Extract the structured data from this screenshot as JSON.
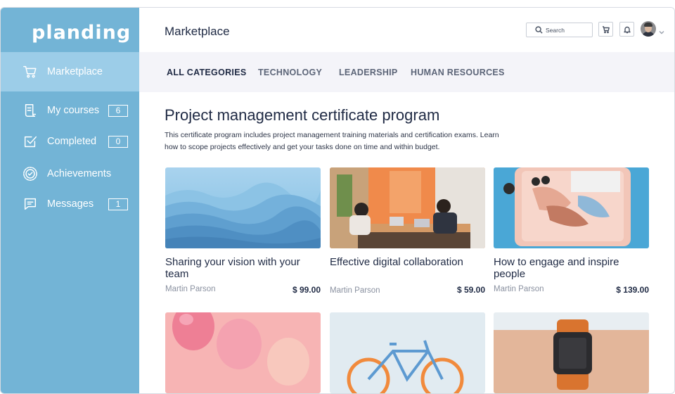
{
  "app": {
    "logo": "planding"
  },
  "sidebar": {
    "items": [
      {
        "label": "Marketplace",
        "count": null
      },
      {
        "label": "My courses",
        "count": "6"
      },
      {
        "label": "Completed",
        "count": "0"
      },
      {
        "label": "Achievements",
        "count": null
      },
      {
        "label": "Messages",
        "count": "1"
      }
    ]
  },
  "header": {
    "title": "Marketplace",
    "search_placeholder": "Search"
  },
  "tabs": [
    "ALL CATEGORIES",
    "TECHNOLOGY",
    "LEADERSHIP",
    "HUMAN RESOURCES"
  ],
  "main": {
    "title": "Project management certificate program",
    "description": "This certificate program includes project management training materials and certification exams. Learn how to scope projects effectively and get your tasks done on time and within budget."
  },
  "courses": [
    {
      "title": "Sharing your vision with your team",
      "author": "Martin Parson",
      "price": "$ 99.00"
    },
    {
      "title": "Effective digital collaboration",
      "author": "Martin Parson",
      "price": "$ 59.00"
    },
    {
      "title": "How to engage and inspire people",
      "author": "Martin Parson",
      "price": "$ 139.00"
    }
  ],
  "icons": {
    "marketplace": "cart-icon",
    "my_courses": "document-list-icon",
    "completed": "checkbox-icon",
    "achievements": "badge-check-icon",
    "messages": "chat-bubble-icon",
    "search": "search-icon",
    "cart": "cart-icon",
    "notifications": "bell-icon",
    "menu": "chevron-down-icon"
  },
  "colors": {
    "sidebar": "#73b4d6",
    "sidebar_active": "#9ccde8",
    "text_primary": "#1f2a44",
    "tab_bar": "#f4f4f9"
  }
}
